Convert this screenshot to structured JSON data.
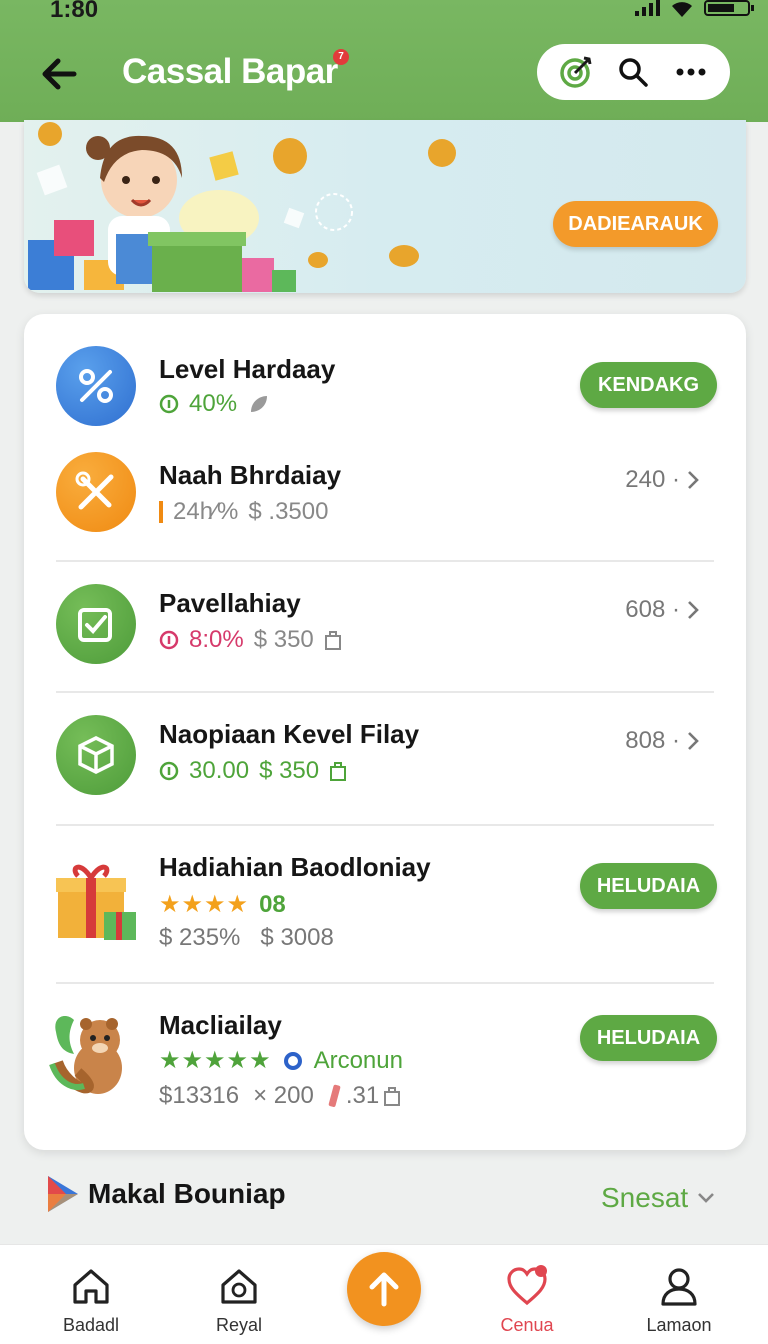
{
  "status": {
    "time": "1:80"
  },
  "header": {
    "title": "Cassal Bapar",
    "notification_badge": "7",
    "actions": [
      "target-icon",
      "search-icon",
      "more-icon"
    ]
  },
  "banner": {
    "button_label": "DADIEARAUK"
  },
  "items": [
    {
      "name": "Level Hardaay",
      "progress": "40%",
      "button": "KENDAKG"
    },
    {
      "name": "Naah Bhrdaiay",
      "stat_a": "24h⁄%",
      "price": "$ .3500",
      "value": "240 ·"
    },
    {
      "name": "Pavellahiay",
      "progress": "8:0%",
      "price": "$ 350",
      "value": "608 ·"
    },
    {
      "name": "Naopiaan Kevel Filay",
      "progress": "30.00",
      "price": "$ 350",
      "value": "808 ·"
    },
    {
      "name": "Hadiahian Baodloniay",
      "stars": "★★★★",
      "rating_text": "08",
      "stat_a": "$ 235%",
      "price": "$ 3008",
      "button": "HELUDAIA"
    },
    {
      "name": "Macliailay",
      "stars": "★★★★★",
      "rating_text": "Arconun",
      "stat_a": "$13316",
      "multiplier": "× 200",
      "extra": ".31",
      "button": "HELUDAIA"
    }
  ],
  "section": {
    "title": "Makal Bouniap",
    "link": "Snesat"
  },
  "bottom_nav": [
    {
      "label": "Badadl",
      "icon": "home-icon"
    },
    {
      "label": "Reyal",
      "icon": "house-badge-icon"
    },
    {
      "label": "Cenua",
      "icon": "heart-icon",
      "active": true
    },
    {
      "label": "Lamaon",
      "icon": "person-icon"
    }
  ],
  "colors": {
    "header": "#6fae57",
    "accent_green": "#5ea944",
    "accent_orange": "#f2921f",
    "active_nav": "#e04650"
  }
}
